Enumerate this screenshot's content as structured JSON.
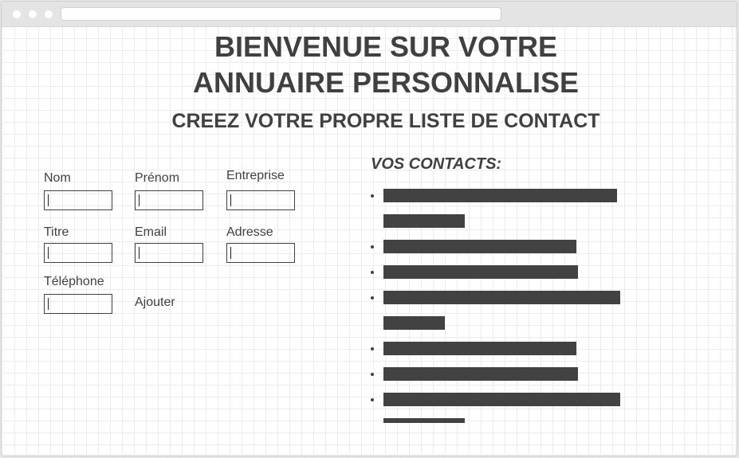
{
  "page": {
    "title_line1": "BIENVENUE SUR VOTRE",
    "title_line2": "ANNUAIRE PERSONNALISE",
    "subtitle": "CREEZ VOTRE PROPRE LISTE DE CONTACT"
  },
  "form": {
    "fields": [
      {
        "key": "nom",
        "label": "Nom",
        "value": ""
      },
      {
        "key": "prenom",
        "label": "Prénom",
        "value": ""
      },
      {
        "key": "entreprise",
        "label": "Entreprise",
        "value": ""
      },
      {
        "key": "titre",
        "label": "Titre",
        "value": ""
      },
      {
        "key": "email",
        "label": "Email",
        "value": ""
      },
      {
        "key": "adresse",
        "label": "Adresse",
        "value": ""
      },
      {
        "key": "telephone",
        "label": "Téléphone",
        "value": ""
      }
    ],
    "submit_label": "Ajouter"
  },
  "contacts": {
    "heading": "VOS CONTACTS:",
    "item_count": 7
  },
  "colors": {
    "text": "#404040",
    "redaction_bar": "#424242",
    "grid_line": "#ececec",
    "background": "#ffffff"
  }
}
